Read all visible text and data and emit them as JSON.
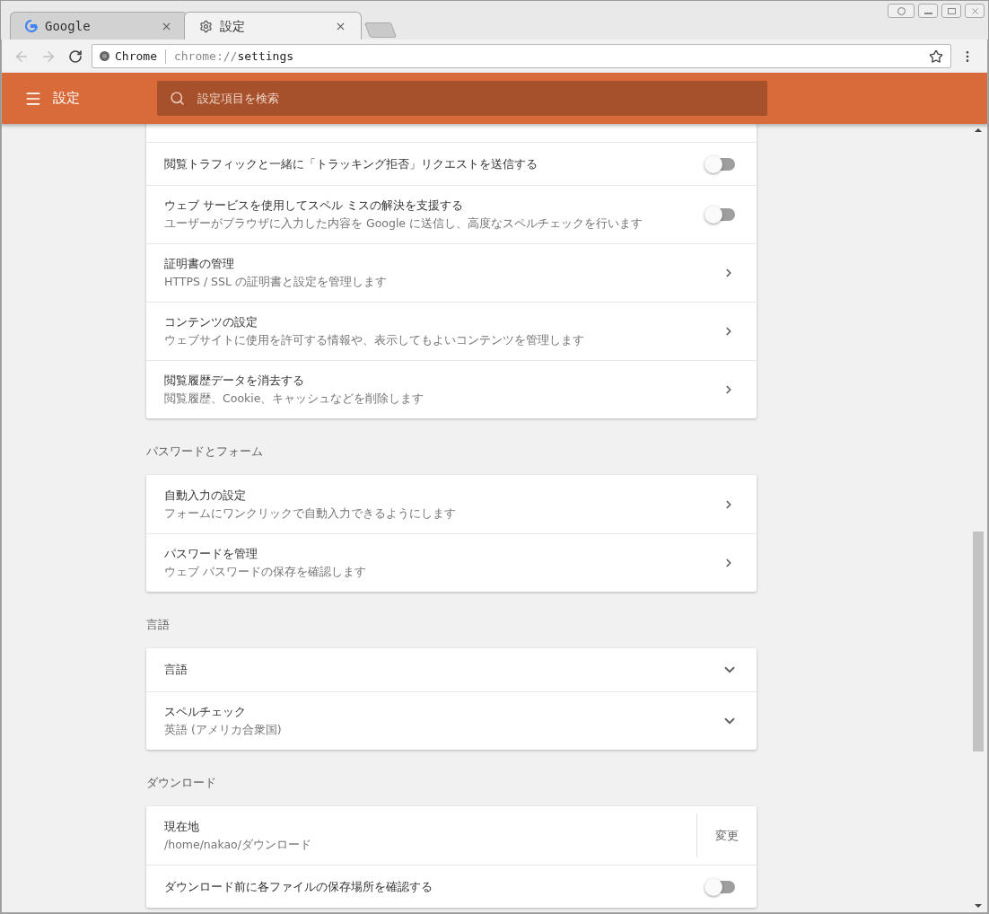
{
  "tabs": [
    {
      "title": "Google",
      "kind": "google",
      "selected": false
    },
    {
      "title": "設定",
      "kind": "gear",
      "selected": true
    }
  ],
  "address": {
    "site_label": "Chrome",
    "url_scheme": "chrome://",
    "url_path": "settings"
  },
  "header": {
    "title": "設定",
    "search": {
      "placeholder": "設定項目を検索"
    }
  },
  "sections": [
    {
      "items": [
        {
          "kind": "toggle",
          "title": "閲覧トラフィックと一緒に「トラッキング拒否」リクエストを送信する",
          "on": false
        },
        {
          "kind": "toggle",
          "title": "ウェブ サービスを使用してスペル ミスの解決を支援する",
          "subtitle": "ユーザーがブラウザに入力した内容を Google に送信し、高度なスペルチェックを行います",
          "on": false
        },
        {
          "kind": "link",
          "title": "証明書の管理",
          "subtitle": "HTTPS / SSL の証明書と設定を管理します"
        },
        {
          "kind": "link",
          "title": "コンテンツの設定",
          "subtitle": "ウェブサイトに使用を許可する情報や、表示してもよいコンテンツを管理します"
        },
        {
          "kind": "link",
          "title": "閲覧履歴データを消去する",
          "subtitle": "閲覧履歴、Cookie、キャッシュなどを削除します"
        }
      ]
    },
    {
      "heading": "パスワードとフォーム",
      "items": [
        {
          "kind": "link",
          "title": "自動入力の設定",
          "subtitle": "フォームにワンクリックで自動入力できるようにします"
        },
        {
          "kind": "link",
          "title": "パスワードを管理",
          "subtitle": "ウェブ パスワードの保存を確認します"
        }
      ]
    },
    {
      "heading": "言語",
      "items": [
        {
          "kind": "expand",
          "title": "言語"
        },
        {
          "kind": "expand",
          "title": "スペルチェック",
          "subtitle": "英語 (アメリカ合衆国)"
        }
      ]
    },
    {
      "heading": "ダウンロード",
      "items": [
        {
          "kind": "action",
          "title": "現在地",
          "subtitle": "/home/nakao/ダウンロード",
          "action": "変更"
        },
        {
          "kind": "toggle",
          "title": "ダウンロード前に各ファイルの保存場所を確認する",
          "on": false
        }
      ]
    }
  ]
}
